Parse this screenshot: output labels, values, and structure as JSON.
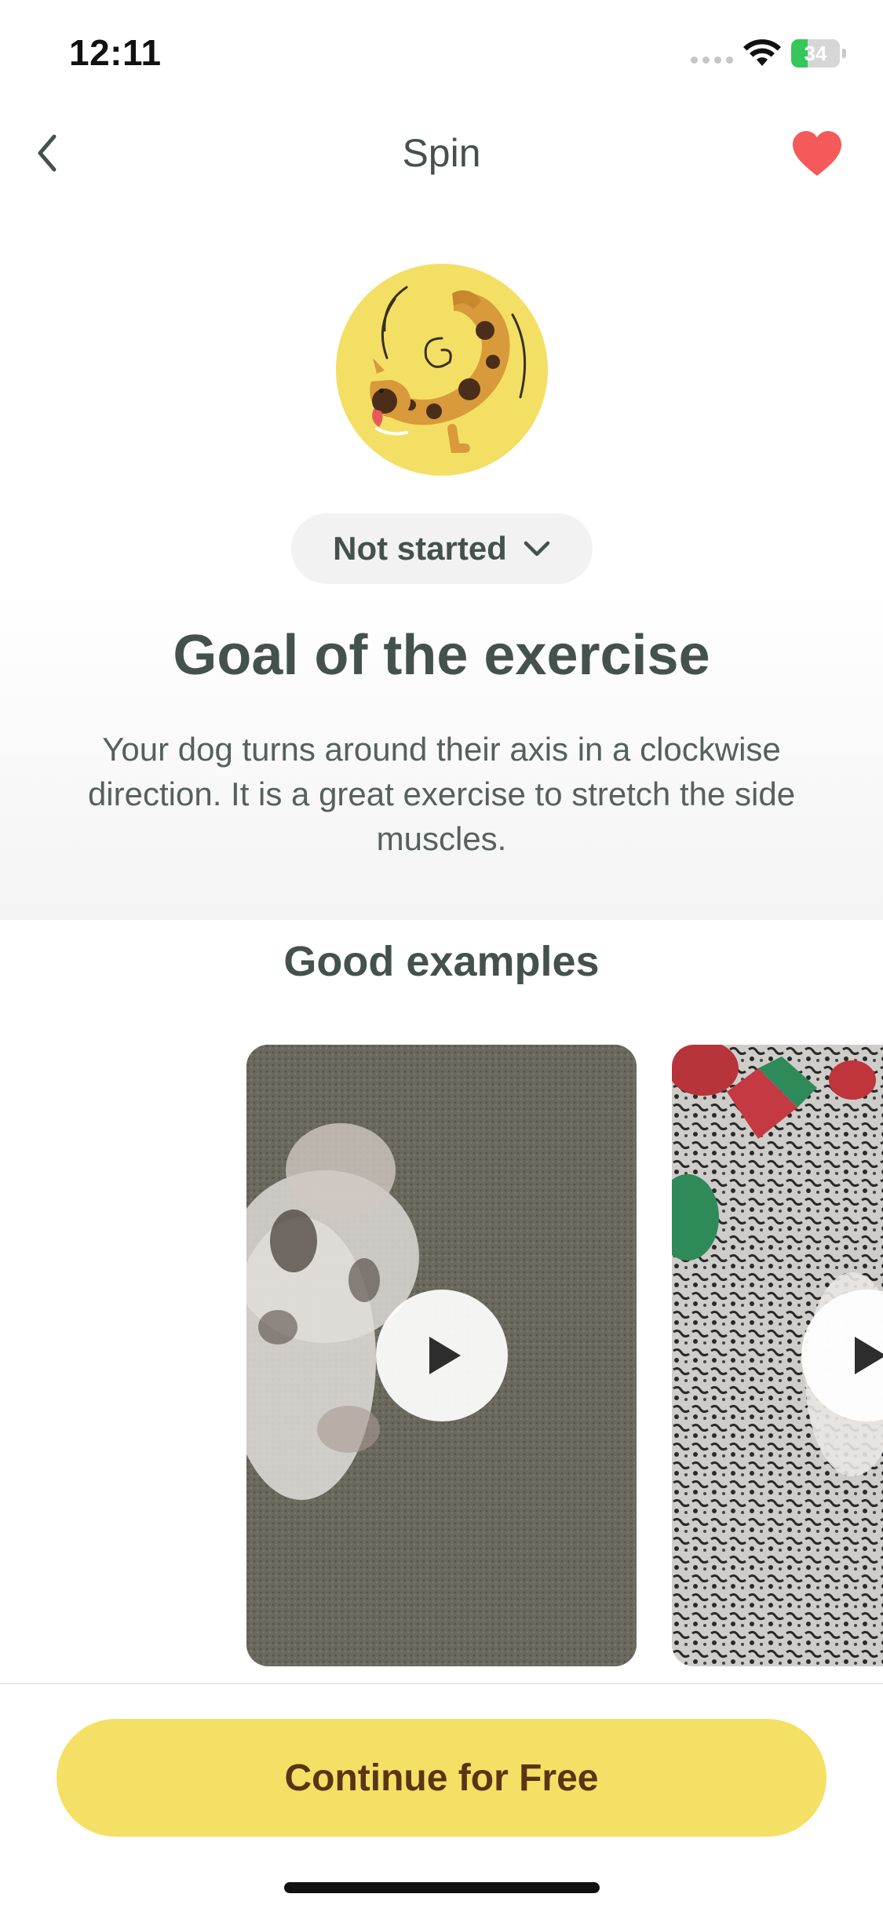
{
  "status_bar": {
    "time": "12:11",
    "battery_percent": "34",
    "battery_level": 0.34,
    "battery_color": "#35c759"
  },
  "nav": {
    "title": "Spin",
    "back_icon": "chevron-left-icon",
    "favorite_icon": "heart-icon",
    "favorite_color": "#f6595a"
  },
  "exercise": {
    "status": "Not started",
    "status_icon": "chevron-down-icon",
    "goal_title": "Goal of the exercise",
    "goal_description": "Your dog turns around their axis in a clockwise direction. It is a great exercise to stretch the side muscles."
  },
  "examples": {
    "title": "Good examples",
    "videos": [
      {
        "icon": "play-icon"
      },
      {
        "icon": "play-icon"
      }
    ]
  },
  "cta": {
    "label": "Continue for Free",
    "color": "#f4e064"
  }
}
